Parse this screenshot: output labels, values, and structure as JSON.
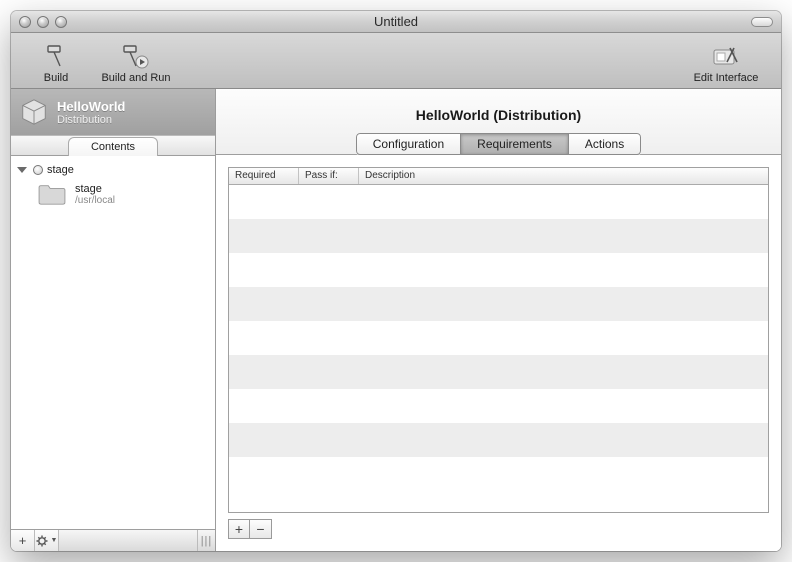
{
  "window": {
    "title": "Untitled"
  },
  "toolbar": {
    "build_label": "Build",
    "build_and_run_label": "Build and Run",
    "edit_interface_label": "Edit Interface"
  },
  "sidebar": {
    "project_name": "HelloWorld",
    "project_subtitle": "Distribution",
    "tab_label": "Contents",
    "root_item": "stage",
    "folder": {
      "name": "stage",
      "path": "/usr/local"
    },
    "footer": {
      "add": "+",
      "gear": "✻",
      "grip": "|||"
    }
  },
  "main": {
    "title": "HelloWorld (Distribution)",
    "tabs": {
      "configuration": "Configuration",
      "requirements": "Requirements",
      "actions": "Actions",
      "active": "Requirements"
    },
    "table": {
      "columns": {
        "required": "Required",
        "passif": "Pass if:",
        "description": "Description"
      },
      "rows": []
    },
    "buttons": {
      "add": "+",
      "remove": "−"
    }
  }
}
